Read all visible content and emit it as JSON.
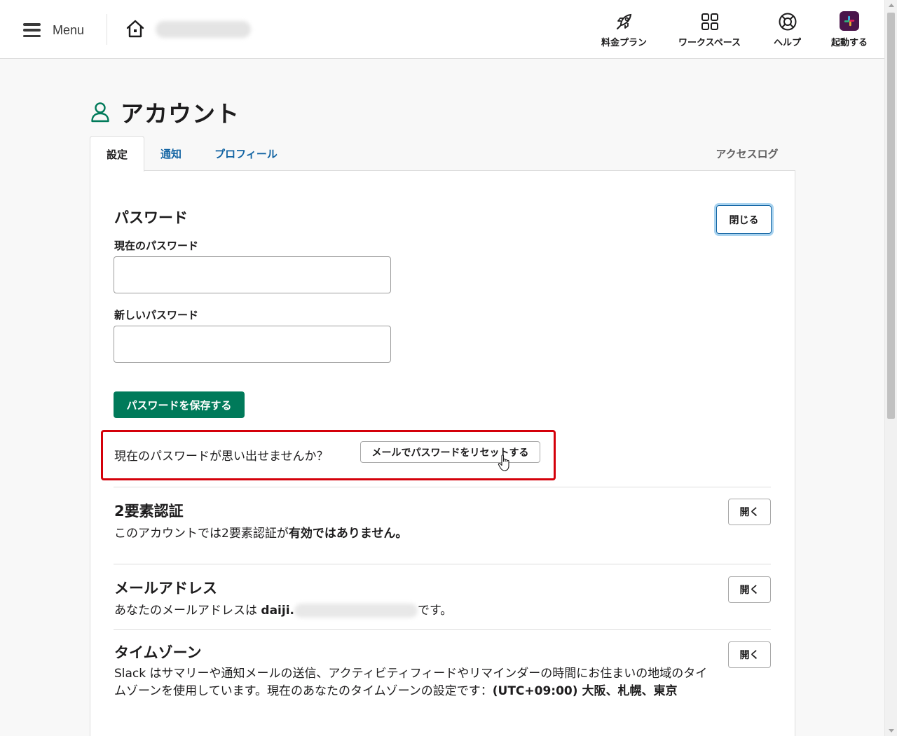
{
  "header": {
    "menu_label": "Menu",
    "nav": [
      {
        "label": "料金プラン",
        "icon": "rocket-icon"
      },
      {
        "label": "ワークスペース",
        "icon": "grid-icon"
      },
      {
        "label": "ヘルプ",
        "icon": "lifebuoy-icon"
      },
      {
        "label": "起動する",
        "icon": "slack-logo-icon"
      }
    ]
  },
  "page": {
    "title": "アカウント",
    "tabs": {
      "settings": "設定",
      "notifications": "通知",
      "profile": "プロフィール"
    },
    "access_log": "アクセスログ"
  },
  "password": {
    "title": "パスワード",
    "close_button": "閉じる",
    "current_label": "現在のパスワード",
    "current_value": "",
    "new_label": "新しいパスワード",
    "new_value": "",
    "save_button": "パスワードを保存する",
    "forgot_text": "現在のパスワードが思い出せませんか？",
    "reset_button": "メールでパスワードをリセットする"
  },
  "two_factor": {
    "title": "2要素認証",
    "desc_prefix": "このアカウントでは2要素認証が",
    "desc_bold": "有効ではありません。",
    "open_button": "開く"
  },
  "email": {
    "title": "メールアドレス",
    "desc_prefix": "あなたのメールアドレスは ",
    "address_visible": "daiji.",
    "desc_suffix": "です。",
    "open_button": "開く"
  },
  "timezone": {
    "title": "タイムゾーン",
    "desc": "Slack はサマリーや通知メールの送信、アクティビティフィードやリマインダーの時間にお住まいの地域のタイムゾーンを使用しています。現在のあなたのタイムゾーンの設定です：",
    "value": "(UTC+09:00) 大阪、札幌、東京",
    "open_button": "開く"
  },
  "colors": {
    "primary_green": "#007a5a",
    "link_blue": "#1264a3",
    "highlight_red": "#d4000a",
    "slack_purple": "#4a154b"
  }
}
